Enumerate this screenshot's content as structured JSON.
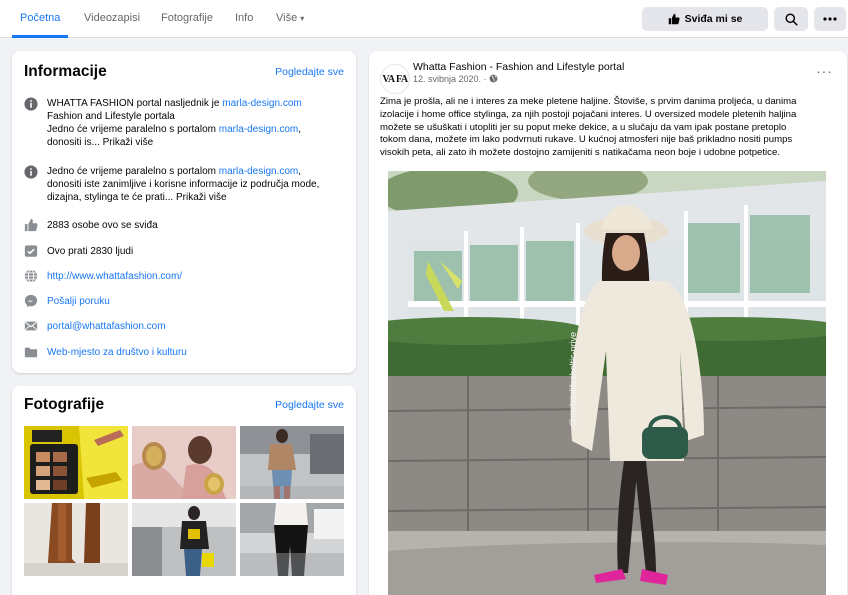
{
  "nav": {
    "tabs": [
      {
        "label": "Početna"
      },
      {
        "label": "Videozapisi"
      },
      {
        "label": "Fotografije"
      },
      {
        "label": "Info"
      },
      {
        "label": "Više"
      }
    ],
    "like_button": "Sviđa mi se",
    "more_caret": "▾"
  },
  "info": {
    "title": "Informacije",
    "see_all": "Pogledajte sve",
    "about1": {
      "pre": "WHATTA FASHION portal nasljednik je ",
      "link1": "marla-design.com",
      "line2": "Fashion and Lifestyle portala",
      "line3_pre": "Jedno će vrijeme paralelno s portalom ",
      "link2": "marla-design.com",
      "line3_post": ",",
      "line4": "donositi is... ",
      "more": "Prikaži više"
    },
    "about2": {
      "pre": "Jedno će vrijeme paralelno s portalom ",
      "link": "marla-design.com",
      "post": ",",
      "line2": "donositi iste zanimljive i korisne informacije iz područja mode,",
      "line3": "dizajna, stylinga te će prati... ",
      "more": "Prikaži više"
    },
    "likes": "2883 osobe ovo se sviđa",
    "follows": "Ovo prati 2830 ljudi",
    "website": "http://www.whattafashion.com/",
    "message": "Pošalji poruku",
    "email": "portal@whattafashion.com",
    "category": "Web-mjesto za društvo i kulturu"
  },
  "photos": {
    "title": "Fotografije",
    "see_all": "Pogledajte sve"
  },
  "post": {
    "avatar": "VA FA",
    "author": "Whatta Fashion - Fashion and Lifestyle portal",
    "date": "12. svibnja 2020. · ",
    "more": "···",
    "text_lines": [
      "Zima je prošla, ali ne i interes za meke pletene haljine. Štoviše, s prvim danima proljeća, u danima",
      "izolacije i home office stylinga, za njih postoji pojačani interes. U oversized modele pletenih haljina",
      "možete se ušuškati i utopliti jer su poput meke dekice, a u slučaju da vam ipak postane pretoplo",
      "tokom dana, možete im lako podvrnuti rukave. U kućnoj atmosferi nije baš prikladno nositi pumps",
      "visokih peta, ali zato ih možete dostojno zamijeniti s natikačama neon boje i udobne potpetice."
    ],
    "photo_credit": "@mylatelifesheltic-prive"
  },
  "colors": {
    "accent": "#1877f2",
    "background": "#f0f2f5",
    "secondary_text": "#65676b"
  }
}
